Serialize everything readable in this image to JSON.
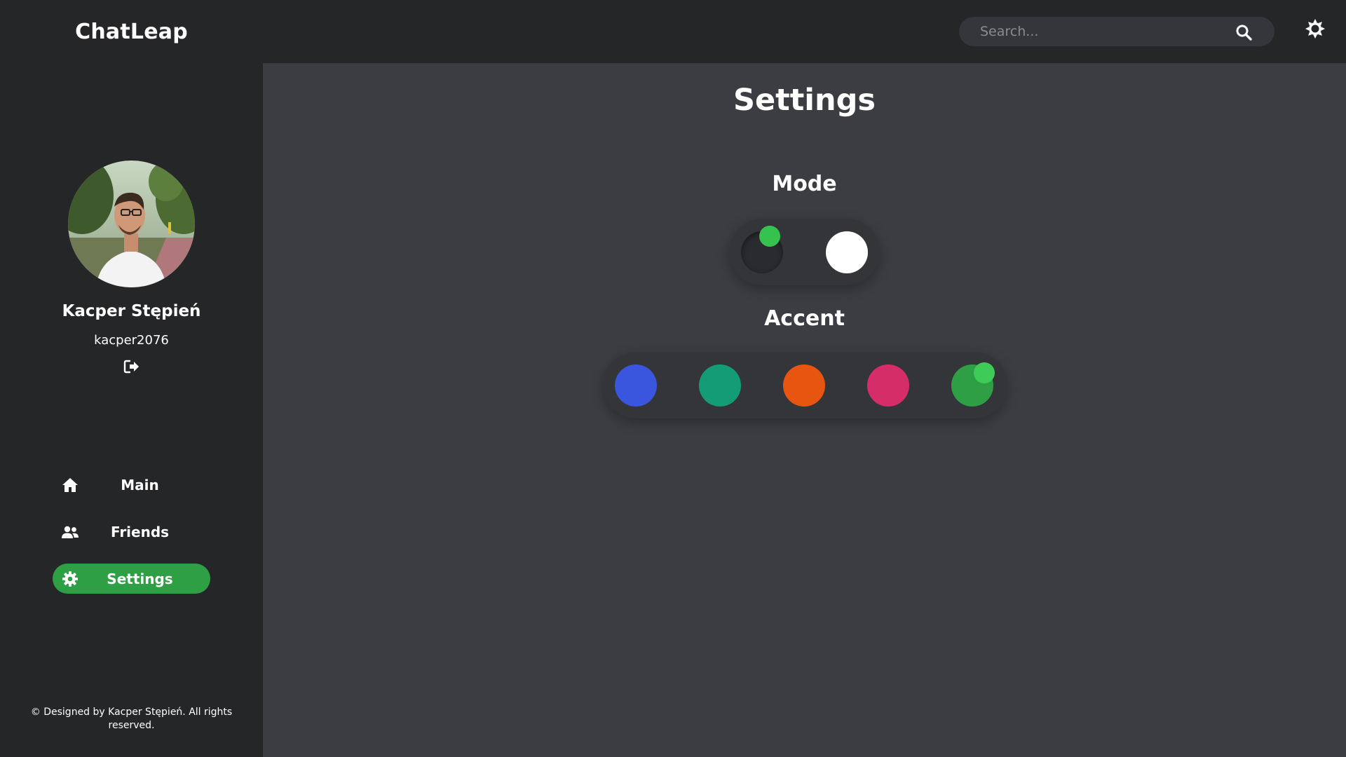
{
  "app": {
    "title": "ChatLeap"
  },
  "profile": {
    "name": "Kacper Stępień",
    "username": "kacper2076",
    "logout_icon": "sign-out-icon"
  },
  "nav": {
    "items": [
      {
        "label": "Main",
        "icon": "home-icon",
        "active": false
      },
      {
        "label": "Friends",
        "icon": "users-icon",
        "active": false
      },
      {
        "label": "Settings",
        "icon": "gear-icon",
        "active": true
      }
    ]
  },
  "footer": {
    "text": "© Designed by Kacper Stępień. All rights reserved."
  },
  "search": {
    "placeholder": "Search...",
    "value": "",
    "icon": "search-icon"
  },
  "topbar": {
    "theme_icon": "sun-icon"
  },
  "main": {
    "title": "Settings",
    "mode": {
      "heading": "Mode",
      "options": [
        "dark",
        "light"
      ],
      "selected": "dark"
    },
    "accent": {
      "heading": "Accent",
      "options": [
        {
          "color": "#3a55de"
        },
        {
          "color": "#139c75"
        },
        {
          "color": "#e85511"
        },
        {
          "color": "#d52d68"
        },
        {
          "color": "#2f9f45"
        }
      ],
      "selected_index": 4
    }
  },
  "colors": {
    "sidebar_bg": "#252628",
    "main_bg": "#3c3d42",
    "accent_active": "#2e9f44",
    "indicator": "#36c24e"
  }
}
